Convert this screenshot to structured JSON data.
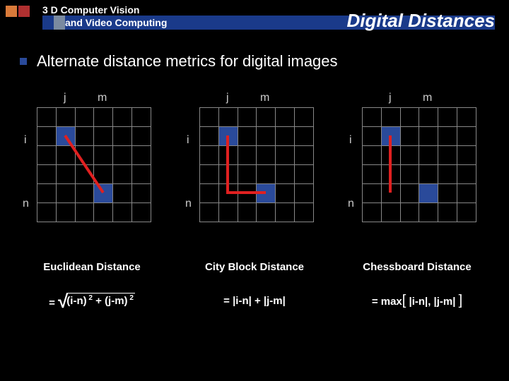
{
  "header": {
    "course_line1": "3 D Computer Vision",
    "course_line2": "and Video Computing",
    "slide_title": "Digital Distances"
  },
  "bullet": {
    "text": "Alternate distance metrics for digital images"
  },
  "grids": {
    "labels": {
      "j": "j",
      "m": "m",
      "i": "i",
      "n": "n"
    }
  },
  "metrics": {
    "euclidean": {
      "name": "Euclidean Distance",
      "formula_prefix": "=",
      "formula_arg": "(i-n) 2 + (j-m) 2"
    },
    "cityblock": {
      "name": "City Block Distance",
      "formula": "= |i-n| + |j-m|"
    },
    "chessboard": {
      "name": "Chessboard Distance",
      "formula_prefix": "= max",
      "formula_lbr": "[",
      "formula_mid": " |i-n|, |j-m| ",
      "formula_rbr": "]"
    }
  }
}
